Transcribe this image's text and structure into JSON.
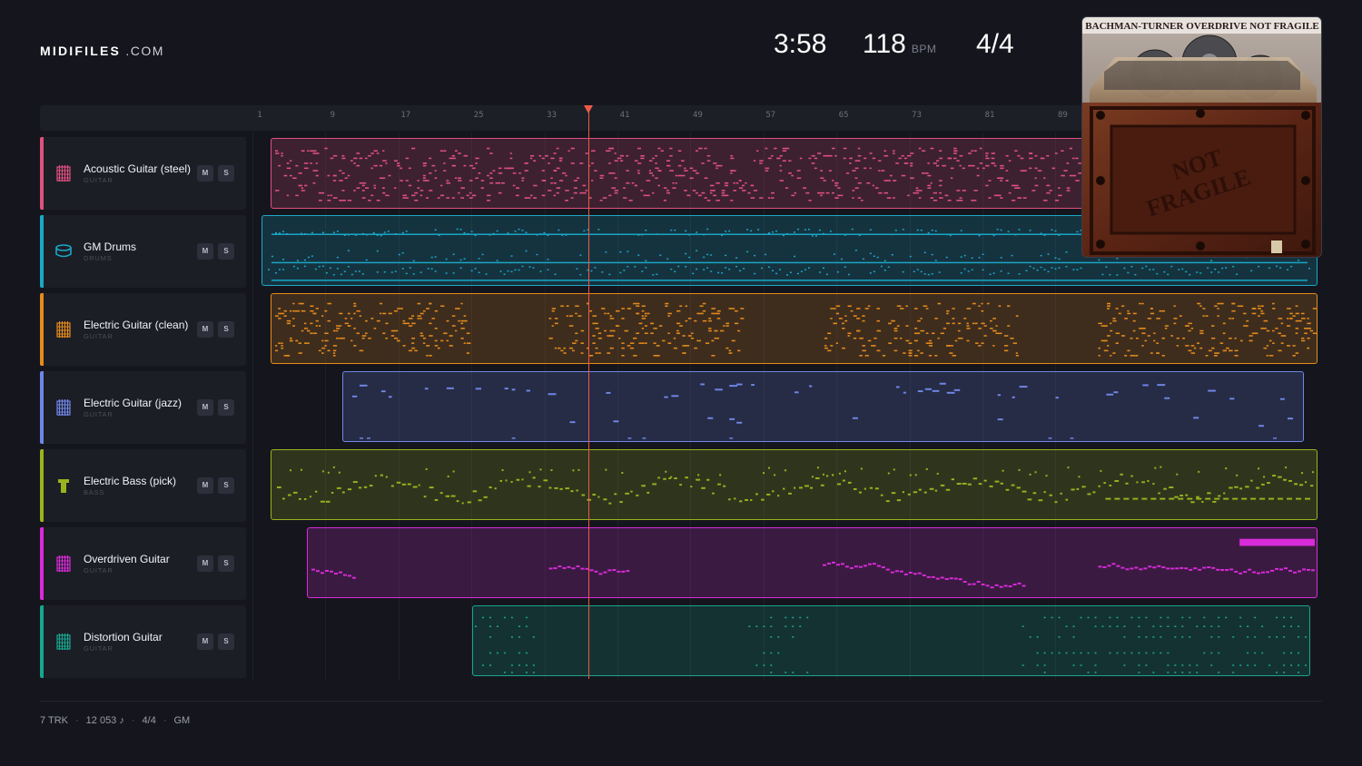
{
  "brand": {
    "name": "MIDIFILES",
    "suffix": ".COM"
  },
  "stats": {
    "duration": "3:58",
    "tempo": "118",
    "tempo_unit": "BPM",
    "meter": "4/4"
  },
  "ruler": {
    "bars": [
      "1",
      "9",
      "17",
      "25",
      "33",
      "41",
      "49",
      "57",
      "65",
      "73",
      "81",
      "89"
    ]
  },
  "playhead": {
    "bar": 37
  },
  "tracks": [
    {
      "name": "Acoustic Guitar (steel)",
      "category": "GUITAR",
      "color": "#e0507f",
      "icon": "guitar-icon",
      "mute": "M",
      "solo": "S"
    },
    {
      "name": "GM Drums",
      "category": "DRUMS",
      "color": "#1aa8c8",
      "icon": "drum-icon",
      "mute": "M",
      "solo": "S"
    },
    {
      "name": "Electric Guitar (clean)",
      "category": "GUITAR",
      "color": "#e58a1c",
      "icon": "guitar-icon",
      "mute": "M",
      "solo": "S"
    },
    {
      "name": "Electric Guitar (jazz)",
      "category": "GUITAR",
      "color": "#6f86e8",
      "icon": "guitar-icon",
      "mute": "M",
      "solo": "S"
    },
    {
      "name": "Electric Bass (pick)",
      "category": "BASS",
      "color": "#9ab21e",
      "icon": "bass-icon",
      "mute": "M",
      "solo": "S"
    },
    {
      "name": "Overdriven Guitar",
      "category": "GUITAR",
      "color": "#d92bd9",
      "icon": "guitar-icon",
      "mute": "M",
      "solo": "S"
    },
    {
      "name": "Distortion Guitar",
      "category": "GUITAR",
      "color": "#17a68e",
      "icon": "guitar-icon",
      "mute": "M",
      "solo": "S"
    }
  ],
  "album": {
    "header": "BACHMAN-TURNER OVERDRIVE  NOT FRAGILE",
    "crate_text_1": "NOT",
    "crate_text_2": "FRAGILE"
  },
  "footer": {
    "tracks": "7 TRK",
    "notes": "12 053 ♪",
    "meter": "4/4",
    "mode": "GM"
  }
}
